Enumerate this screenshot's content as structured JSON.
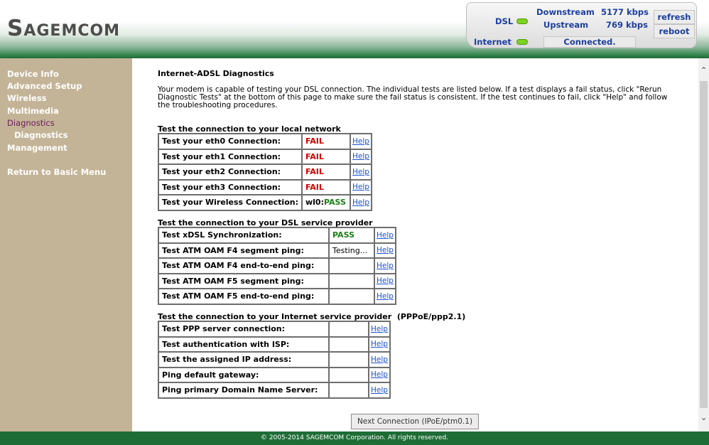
{
  "header": {
    "logo": "Sagemcom",
    "dsl_label": "DSL",
    "internet_label": "Internet",
    "downstream_label": "Downstream",
    "downstream_value": "5177 kbps",
    "upstream_label": "Upstream",
    "upstream_value": "769 kbps",
    "internet_status": "Connected.",
    "refresh_label": "refresh",
    "reboot_label": "reboot",
    "led_color": "#7ed321"
  },
  "sidebar": {
    "items": [
      {
        "label": "Device Info"
      },
      {
        "label": "Advanced Setup"
      },
      {
        "label": "Wireless"
      },
      {
        "label": "Multimedia"
      },
      {
        "label": "Diagnostics"
      },
      {
        "label": "Diagnostics"
      },
      {
        "label": "Management"
      }
    ],
    "return_label": "Return to Basic Menu"
  },
  "content": {
    "title": "Internet-ADSL Diagnostics",
    "intro": "Your modem is capable of testing your DSL connection. The individual tests are listed below. If a test displays a fail status, click \"Rerun Diagnostic Tests\" at the bottom of this page to make sure the fail status is consistent. If the test continues to fail, click \"Help\" and follow the troubleshooting procedures.",
    "local": {
      "title": "Test the connection to your local network",
      "rows": [
        {
          "label": "Test your eth0 Connection:",
          "result_prefix": "",
          "result": "FAIL",
          "help": "Help"
        },
        {
          "label": "Test your eth1 Connection:",
          "result_prefix": "",
          "result": "FAIL",
          "help": "Help"
        },
        {
          "label": "Test your eth2 Connection:",
          "result_prefix": "",
          "result": "FAIL",
          "help": "Help"
        },
        {
          "label": "Test your eth3 Connection:",
          "result_prefix": "",
          "result": "FAIL",
          "help": "Help"
        },
        {
          "label": "Test your Wireless Connection:",
          "result_prefix": "wl0:",
          "result": "PASS",
          "help": "Help"
        }
      ]
    },
    "dsl": {
      "title": "Test the connection to your DSL service provider",
      "rows": [
        {
          "label": "Test xDSL Synchronization:",
          "result": "PASS",
          "help": "Help"
        },
        {
          "label": "Test ATM OAM F4 segment ping:",
          "result": "Testing...",
          "help": "Help"
        },
        {
          "label": "Test ATM OAM F4 end-to-end ping:",
          "result": "",
          "help": "Help"
        },
        {
          "label": "Test ATM OAM F5 segment ping:",
          "result": "",
          "help": "Help"
        },
        {
          "label": "Test ATM OAM F5 end-to-end ping:",
          "result": "",
          "help": "Help"
        }
      ]
    },
    "isp": {
      "title": "Test the connection to your Internet service provider",
      "title_suffix": "(PPPoE/ppp2.1)",
      "rows": [
        {
          "label": "Test PPP server connection:",
          "result": "",
          "help": "Help"
        },
        {
          "label": "Test authentication with ISP:",
          "result": "",
          "help": "Help"
        },
        {
          "label": "Test the assigned IP address:",
          "result": "",
          "help": "Help"
        },
        {
          "label": "Ping default gateway:",
          "result": "",
          "help": "Help"
        },
        {
          "label": "Ping primary Domain Name Server:",
          "result": "",
          "help": "Help"
        }
      ]
    },
    "next_button": "Next Connection (IPoE/ptm0.1)"
  },
  "footer": {
    "copyright": "© 2005-2014 SAGEMCOM Corporation. All rights reserved."
  },
  "colors": {
    "fail": "#d10000",
    "pass": "#1a7f15",
    "sidebar_bg": "#c4b497",
    "footer_bg": "#1f6d36",
    "selected_nav": "#6a1b5c"
  }
}
